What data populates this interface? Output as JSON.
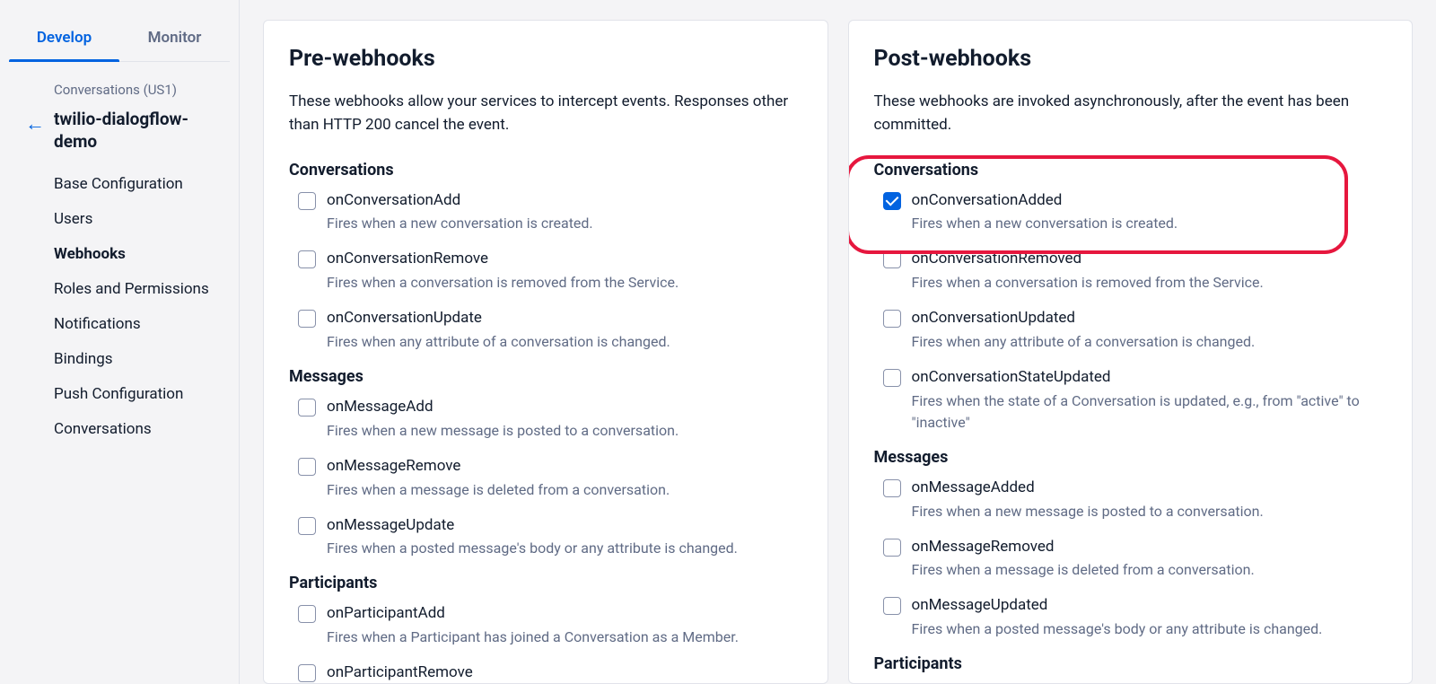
{
  "sidebar": {
    "tabs": [
      "Develop",
      "Monitor"
    ],
    "active_tab": 0,
    "breadcrumb": "Conversations (US1)",
    "project": "twilio-dialogflow-demo",
    "nav": [
      {
        "label": "Base Configuration"
      },
      {
        "label": "Users"
      },
      {
        "label": "Webhooks",
        "active": true
      },
      {
        "label": "Roles and Permissions"
      },
      {
        "label": "Notifications"
      },
      {
        "label": "Bindings"
      },
      {
        "label": "Push Configuration"
      },
      {
        "label": "Conversations"
      }
    ]
  },
  "pre": {
    "title": "Pre-webhooks",
    "desc": "These webhooks allow your services to intercept events. Responses other than HTTP 200 cancel the event.",
    "groups": [
      {
        "heading": "Conversations",
        "items": [
          {
            "label": "onConversationAdd",
            "desc": "Fires when a new conversation is created.",
            "checked": false
          },
          {
            "label": "onConversationRemove",
            "desc": "Fires when a conversation is removed from the Service.",
            "checked": false
          },
          {
            "label": "onConversationUpdate",
            "desc": "Fires when any attribute of a conversation is changed.",
            "checked": false
          }
        ]
      },
      {
        "heading": "Messages",
        "items": [
          {
            "label": "onMessageAdd",
            "desc": "Fires when a new message is posted to a conversation.",
            "checked": false
          },
          {
            "label": "onMessageRemove",
            "desc": "Fires when a message is deleted from a conversation.",
            "checked": false
          },
          {
            "label": "onMessageUpdate",
            "desc": "Fires when a posted message's body or any attribute is changed.",
            "checked": false
          }
        ]
      },
      {
        "heading": "Participants",
        "items": [
          {
            "label": "onParticipantAdd",
            "desc": "Fires when a Participant has joined a Conversation as a Member.",
            "checked": false
          },
          {
            "label": "onParticipantRemove",
            "desc": "",
            "checked": false
          }
        ]
      }
    ]
  },
  "post": {
    "title": "Post-webhooks",
    "desc": "These webhooks are invoked asynchronously, after the event has been committed.",
    "groups": [
      {
        "heading": "Conversations",
        "items": [
          {
            "label": "onConversationAdded",
            "desc": "Fires when a new conversation is created.",
            "checked": true,
            "highlight": true
          },
          {
            "label": "onConversationRemoved",
            "desc": "Fires when a conversation is removed from the Service.",
            "checked": false
          },
          {
            "label": "onConversationUpdated",
            "desc": "Fires when any attribute of a conversation is changed.",
            "checked": false
          },
          {
            "label": "onConversationStateUpdated",
            "desc": "Fires when the state of a Conversation is updated, e.g., from \"active\" to \"inactive\"",
            "checked": false
          }
        ]
      },
      {
        "heading": "Messages",
        "items": [
          {
            "label": "onMessageAdded",
            "desc": "Fires when a new message is posted to a conversation.",
            "checked": false
          },
          {
            "label": "onMessageRemoved",
            "desc": "Fires when a message is deleted from a conversation.",
            "checked": false
          },
          {
            "label": "onMessageUpdated",
            "desc": "Fires when a posted message's body or any attribute is changed.",
            "checked": false
          }
        ]
      },
      {
        "heading": "Participants",
        "items": []
      }
    ]
  }
}
